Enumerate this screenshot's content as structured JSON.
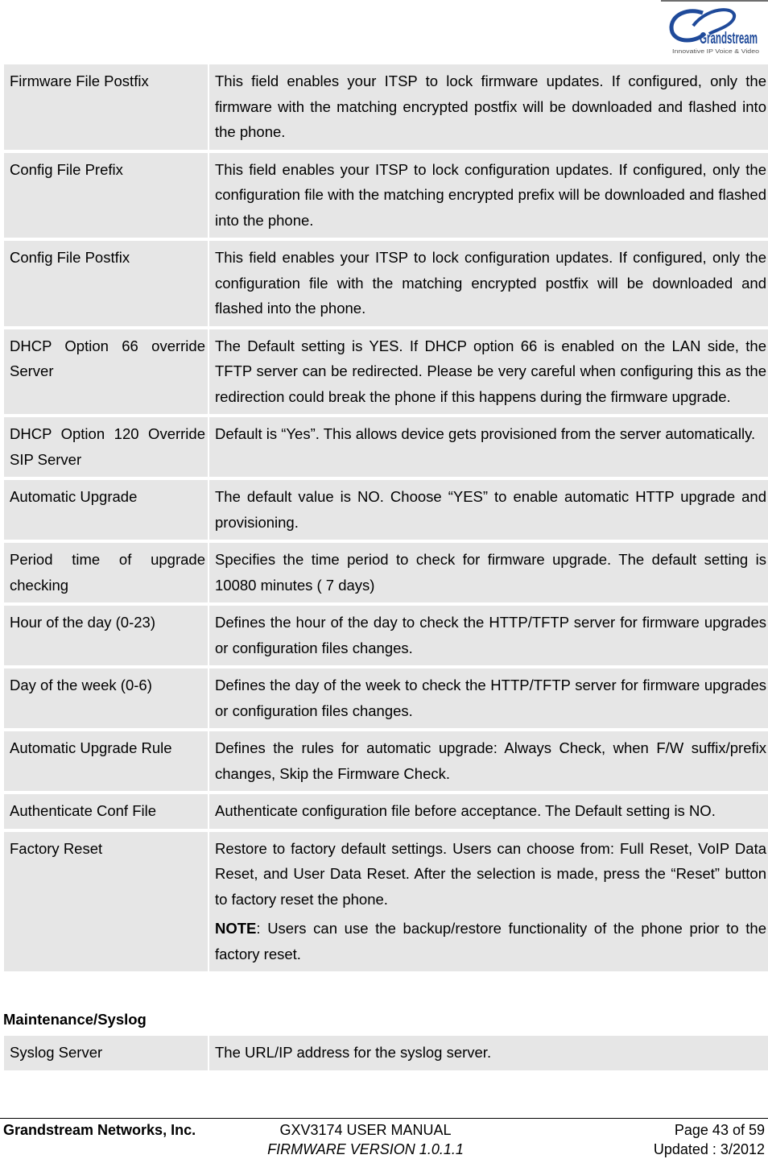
{
  "header": {
    "logo": {
      "brand": "Grandstream",
      "tagline": "Innovative IP Voice & Video",
      "icon": "grandstream-logo-icon"
    }
  },
  "table1": {
    "rows": [
      {
        "label": "Firmware File Postfix",
        "desc": [
          "This field enables your ITSP to lock firmware updates. If configured, only the firmware with the matching encrypted postfix will be downloaded and flashed into the phone."
        ]
      },
      {
        "label": "Config File Prefix",
        "desc": [
          "This field enables your ITSP to lock configuration updates. If configured, only the configuration file with the matching encrypted prefix will be downloaded and flashed into the phone."
        ]
      },
      {
        "label": "Config File Postfix",
        "desc": [
          "This field enables your ITSP to lock configuration updates. If configured, only the configuration file with the matching encrypted postfix will be downloaded and flashed into the phone."
        ]
      },
      {
        "label": "DHCP Option 66 override Server",
        "desc": [
          "The Default setting is YES. If DHCP option 66 is enabled on the LAN side, the TFTP server can be redirected. Please be very careful when configuring this as the redirection could break the phone if this happens during the firmware upgrade."
        ]
      },
      {
        "label": "DHCP Option 120 Override SIP Server",
        "desc": [
          "Default is “Yes”. This allows device gets provisioned from the server automatically."
        ]
      },
      {
        "label": "Automatic Upgrade",
        "desc": [
          "The default value is NO. Choose “YES” to enable automatic HTTP upgrade and provisioning."
        ]
      },
      {
        "label": "Period time of upgrade checking",
        "desc": [
          "Specifies the time period to check for firmware upgrade. The default setting is 10080 minutes ( 7 days)"
        ]
      },
      {
        "label": "Hour of the day (0-23)",
        "desc": [
          "Defines the hour of the day to check the HTTP/TFTP server for firmware upgrades or configuration files changes."
        ]
      },
      {
        "label": "Day of the week (0-6)",
        "desc": [
          "Defines the day of the week to check the HTTP/TFTP server for firmware upgrades or configuration files changes."
        ]
      },
      {
        "label": "Automatic Upgrade Rule",
        "desc": [
          "Defines the rules for automatic upgrade: Always Check, when F/W suffix/prefix changes, Skip the Firmware Check."
        ]
      },
      {
        "label": "Authenticate Conf File",
        "desc": [
          "Authenticate configuration file before acceptance. The Default setting is NO."
        ]
      },
      {
        "label": "Factory Reset",
        "desc": [
          "Restore to factory default settings. Users can choose from: Full Reset, VoIP Data Reset, and User Data Reset. After the selection is made, press the “Reset” button to factory reset the phone."
        ],
        "note": {
          "prefix": "NOTE",
          "text": ": Users can use the backup/restore functionality of the phone prior to the factory reset."
        }
      }
    ]
  },
  "section2": {
    "title": "Maintenance/Syslog",
    "rows": [
      {
        "label": "Syslog Server",
        "desc": [
          "The URL/IP address for the syslog server."
        ]
      }
    ]
  },
  "footer": {
    "company": "Grandstream Networks, Inc.",
    "manual": "GXV3174 USER MANUAL",
    "firmware": "FIRMWARE VERSION 1.0.1.1",
    "page": "Page 43 of 59",
    "updated": "Updated : 3/2012"
  }
}
